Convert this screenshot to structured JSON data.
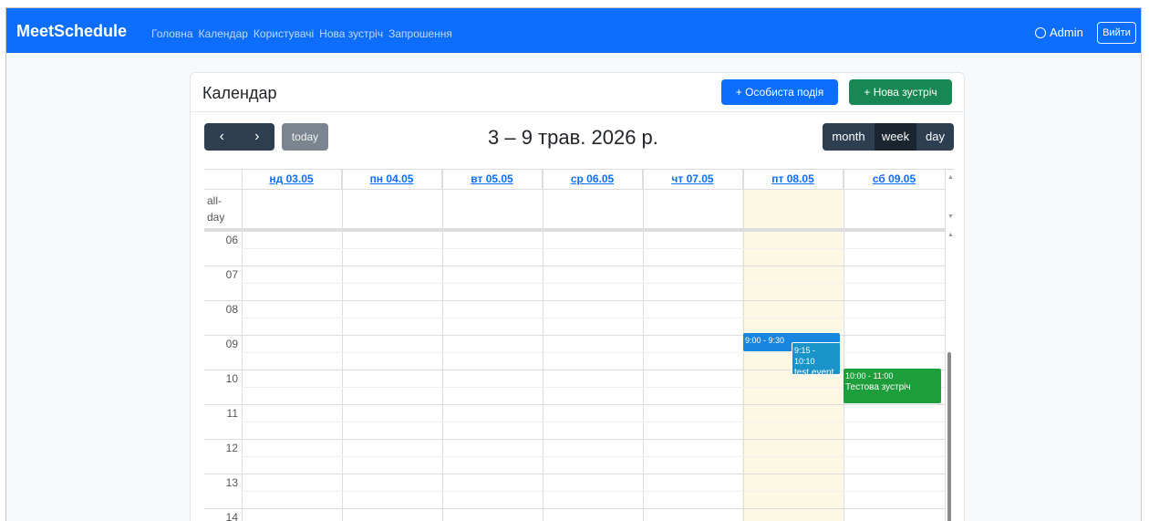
{
  "navbar": {
    "brand": "MeetSchedule",
    "links": [
      "Головна",
      "Календар",
      "Користувачі",
      "Нова зустріч",
      "Запрошення"
    ],
    "user_label": "Admin",
    "logout_label": "Вийти",
    "background_color": "#0d6efd"
  },
  "card": {
    "title": "Календар",
    "personal_event_label": "+ Особиста подія",
    "new_meeting_label": "+ Нова зустріч"
  },
  "toolbar": {
    "prev_icon": "‹",
    "next_icon": "›",
    "today_label": "today",
    "title": "3 – 9 трав. 2026 р.",
    "views": [
      "month",
      "week",
      "day"
    ],
    "active_view": "week"
  },
  "calendar": {
    "days": [
      "нд 03.05",
      "пн 04.05",
      "вт 05.05",
      "ср 06.05",
      "чт 07.05",
      "пт 08.05",
      "сб 09.05"
    ],
    "today_index": 5,
    "allday_label": "all-\nday",
    "hours": [
      "06",
      "07",
      "08",
      "09",
      "10",
      "11",
      "12",
      "13",
      "14"
    ],
    "events": [
      {
        "time": "9:00 - 9:30",
        "title": "",
        "color": "#1886df"
      },
      {
        "time": "9:15 - 10:10",
        "title": "test event",
        "color": "#1a93c9"
      },
      {
        "time": "10:00 - 11:00",
        "title": "Тестова зустріч",
        "color": "#1e9e3a"
      }
    ]
  }
}
